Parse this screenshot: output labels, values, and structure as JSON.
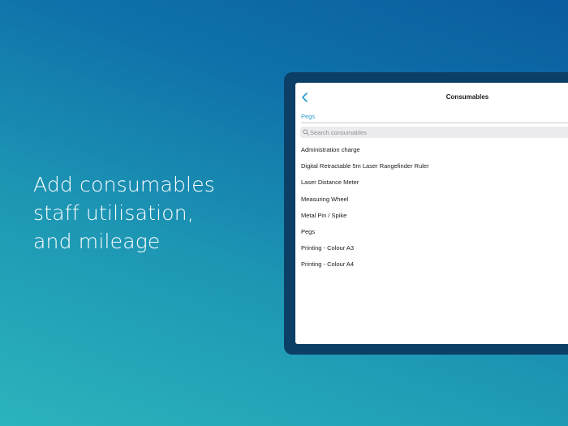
{
  "promo": {
    "headline_lines": [
      "Add consumables",
      "staff utilisation,",
      "and mileage"
    ]
  },
  "screen": {
    "nav": {
      "title": "Consumables",
      "back_icon": "chevron-left-icon"
    },
    "selected_value": "Pegs",
    "search": {
      "placeholder": "Search consumables",
      "value": "",
      "icon": "search-icon"
    },
    "items": [
      "Administration charge",
      "Digital Retractable 5m Laser Rangefinder Ruler",
      "Laser Distance Meter",
      "Measuring Wheel",
      "Metal Pin / Spike",
      "Pegs",
      "Printing - Colour A3",
      "Printing - Colour A4"
    ]
  },
  "colors": {
    "accent": "#2a9bcd",
    "tablet_frame": "#0c3f66",
    "background_start": "#2bb4bc",
    "background_end": "#0a5c9f"
  }
}
